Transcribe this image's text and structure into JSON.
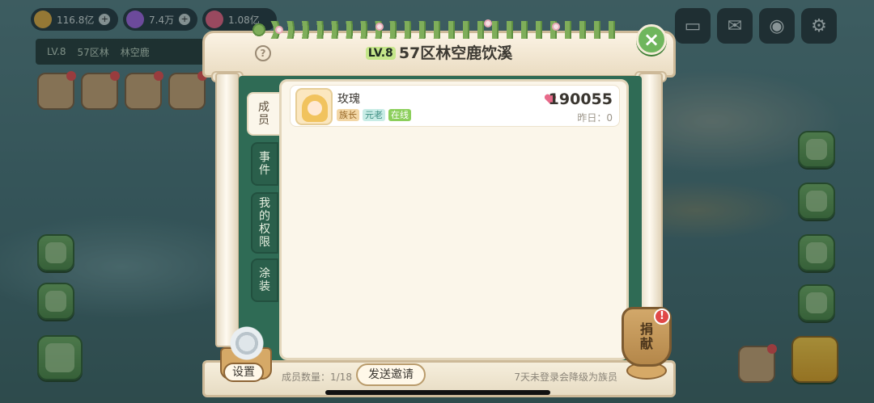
{
  "hud": {
    "currencies": [
      {
        "icon": "gold-coin-icon",
        "value": "116.8亿",
        "color": "#d9a33a"
      },
      {
        "icon": "purple-gem-icon",
        "value": "7.4万",
        "color": "#9b5dd6"
      },
      {
        "icon": "heart-icon",
        "value": "1.08亿",
        "color": "#e05b7a"
      }
    ],
    "info_bar": [
      "LV.8",
      "57区林",
      "林空鹿"
    ]
  },
  "dialog": {
    "level": "LV.8",
    "title": "57区林空鹿饮溪",
    "tabs": [
      {
        "label": [
          "成",
          "员"
        ],
        "active": true
      },
      {
        "label": [
          "事",
          "件"
        ],
        "active": false
      },
      {
        "label": [
          "我",
          "的",
          "权",
          "限"
        ],
        "active": false
      },
      {
        "label": [
          "涂",
          "装"
        ],
        "active": false
      }
    ],
    "members": [
      {
        "name": "玫瑰",
        "badges": [
          "族长",
          "元老",
          "在线"
        ],
        "score": "190055",
        "yesterday": "昨日：0"
      }
    ],
    "footer": {
      "settings_label": "设置",
      "member_count": "成员数量：1/18",
      "invite_label": "发送邀请",
      "notice": "7天未登录会降级为族员"
    },
    "donate_label": [
      "捐",
      "献"
    ],
    "donate_alert": "!",
    "close_icon": "×",
    "help_icon": "?"
  }
}
